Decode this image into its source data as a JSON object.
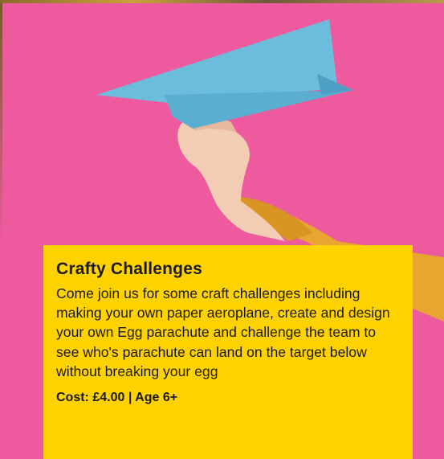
{
  "card": {
    "title": "Crafty Challenges",
    "description": "Come join us for some craft challenges including making your own paper aeroplane, create and design your  own Egg parachute and challenge the team to see who's parachute can land on the target below without breaking your egg",
    "cost": "Cost: £4.00 | Age 6+"
  },
  "colors": {
    "background": "#ee5a9e",
    "card": "#ffd200",
    "plane": "#7fc8e2",
    "sleeve": "#e8a630"
  },
  "image": {
    "icon": "paper-aeroplane-photo"
  }
}
